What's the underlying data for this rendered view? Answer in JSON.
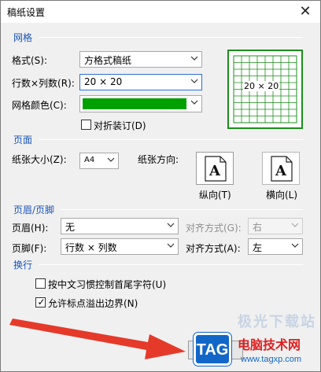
{
  "dialog": {
    "title": "稿纸设置",
    "close_icon": "close-icon"
  },
  "grid_section": {
    "heading": "网格",
    "style_label": "格式(S):",
    "style_value": "方格式稿纸",
    "rows_cols_label": "行数×列数(R):",
    "rows_cols_value": "20 × 20",
    "color_label": "网格颜色(C):",
    "color_value": "#00a000",
    "fold_label": "对折装订(D)",
    "fold_checked": false,
    "preview_text": "20 × 20",
    "preview_color": "#1a8f1a"
  },
  "page_section": {
    "heading": "页面",
    "size_label": "纸张大小(Z):",
    "size_value": "A4",
    "orientation_label": "纸张方向:",
    "portrait_label": "纵向(T)",
    "landscape_label": "横向(L)",
    "page_glyph": "A"
  },
  "header_footer_section": {
    "heading": "页眉/页脚",
    "header_label": "页眉(H):",
    "header_value": "无",
    "header_align_label": "对齐方式(G):",
    "header_align_value": "右",
    "footer_label": "页脚(F):",
    "footer_value": "行数 × 列数",
    "footer_align_label": "对齐方式(A):",
    "footer_align_value": "左"
  },
  "wrap_section": {
    "heading": "换行",
    "option1_label": "按中文习惯控制首尾字符(U)",
    "option1_checked": false,
    "option2_label": "允许标点溢出边界(N)",
    "option2_checked": true
  },
  "watermark": {
    "badge": "TAG",
    "site_name": "电脑技术网",
    "url": "www.tagxp.com",
    "faded_text": "极光下载站"
  },
  "colors": {
    "accent_blue": "#1b55b8",
    "arrow_red": "#e53a2a",
    "badge_blue": "#1166c8",
    "site_red": "#e02020"
  }
}
